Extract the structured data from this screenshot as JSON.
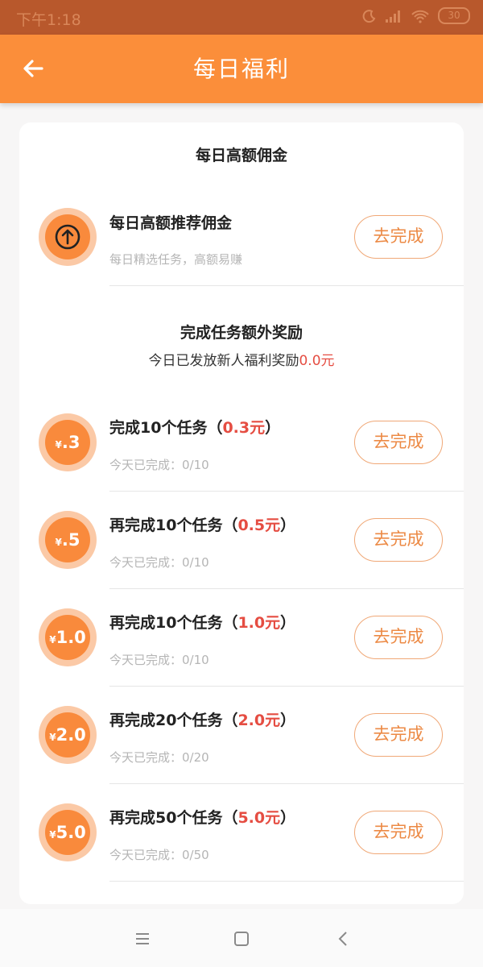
{
  "status": {
    "time": "下午1:18",
    "battery": "30"
  },
  "header": {
    "title": "每日福利",
    "back_icon": "arrow-left-icon"
  },
  "commission": {
    "section_title": "每日高额佣金",
    "item": {
      "title": "每日高额推荐佣金",
      "subtitle": "每日精选任务，高额易赚",
      "button": "去完成",
      "icon": "arrow-up-circle-icon"
    }
  },
  "extra": {
    "section_title": "完成任务额外奖励",
    "subtitle_prefix": "今日已发放新人福利奖励",
    "subtitle_amount": "0.0元",
    "tasks": [
      {
        "badge_yen": "¥",
        "badge_value": ".3",
        "title_prefix": "完成10个任务（",
        "amount": "0.3元",
        "title_suffix": "）",
        "progress": "今天已完成：0/10",
        "button": "去完成"
      },
      {
        "badge_yen": "¥",
        "badge_value": ".5",
        "title_prefix": "再完成10个任务（",
        "amount": "0.5元",
        "title_suffix": "）",
        "progress": "今天已完成：0/10",
        "button": "去完成"
      },
      {
        "badge_yen": "¥",
        "badge_value": "1.0",
        "title_prefix": "再完成10个任务（",
        "amount": "1.0元",
        "title_suffix": "）",
        "progress": "今天已完成：0/10",
        "button": "去完成"
      },
      {
        "badge_yen": "¥",
        "badge_value": "2.0",
        "title_prefix": "再完成20个任务（",
        "amount": "2.0元",
        "title_suffix": "）",
        "progress": "今天已完成：0/20",
        "button": "去完成"
      },
      {
        "badge_yen": "¥",
        "badge_value": "5.0",
        "title_prefix": "再完成50个任务（",
        "amount": "5.0元",
        "title_suffix": "）",
        "progress": "今天已完成：0/50",
        "button": "去完成"
      }
    ]
  },
  "nav": {
    "menu_icon": "menu-icon",
    "home_icon": "square-home-icon",
    "back_icon": "chevron-left-icon"
  }
}
